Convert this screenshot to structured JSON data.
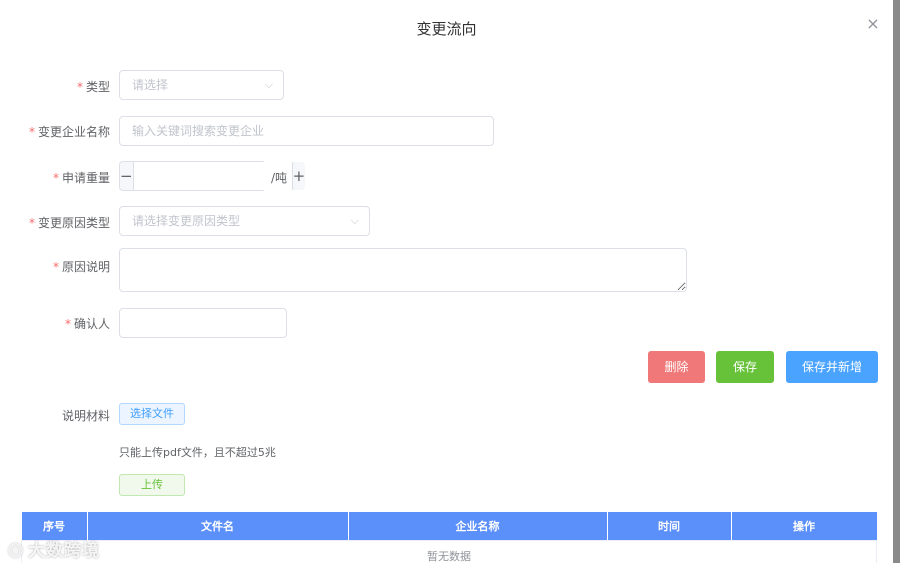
{
  "dialog": {
    "title": "变更流向",
    "close_symbol": "×"
  },
  "form": {
    "type": {
      "label": "类型",
      "placeholder": "请选择"
    },
    "company": {
      "label": "变更企业名称",
      "placeholder": "输入关键词搜索变更企业"
    },
    "quantity": {
      "label": "申请重量",
      "value": "",
      "unit": "/吨",
      "minus": "−",
      "plus": "+"
    },
    "reason_type": {
      "label": "变更原因类型",
      "placeholder": "请选择变更原因类型"
    },
    "reason_desc": {
      "label": "原因说明",
      "value": ""
    },
    "confirmer": {
      "label": "确认人",
      "value": ""
    },
    "required_mark": "*"
  },
  "actions": {
    "delete_label": "删除",
    "save_label": "保存",
    "save_new_label": "保存并新增"
  },
  "materials": {
    "label": "说明材料",
    "choose_label": "选择文件",
    "hint": "只能上传pdf文件，且不超过5兆",
    "upload_label": "上传"
  },
  "table": {
    "columns": [
      "序号",
      "文件名",
      "企业名称",
      "时间",
      "操作"
    ],
    "empty_text": "暂无数据"
  },
  "watermark": {
    "logo": "⦿",
    "text": "大数跨境"
  },
  "icons": {
    "chevron": "chevron-down-icon",
    "close": "close-icon"
  },
  "colors": {
    "delete": "#f07878",
    "save": "#67c23a",
    "save_new": "#4aa3ff",
    "table_header": "#5b8ff9",
    "required": "#f56c6c"
  }
}
